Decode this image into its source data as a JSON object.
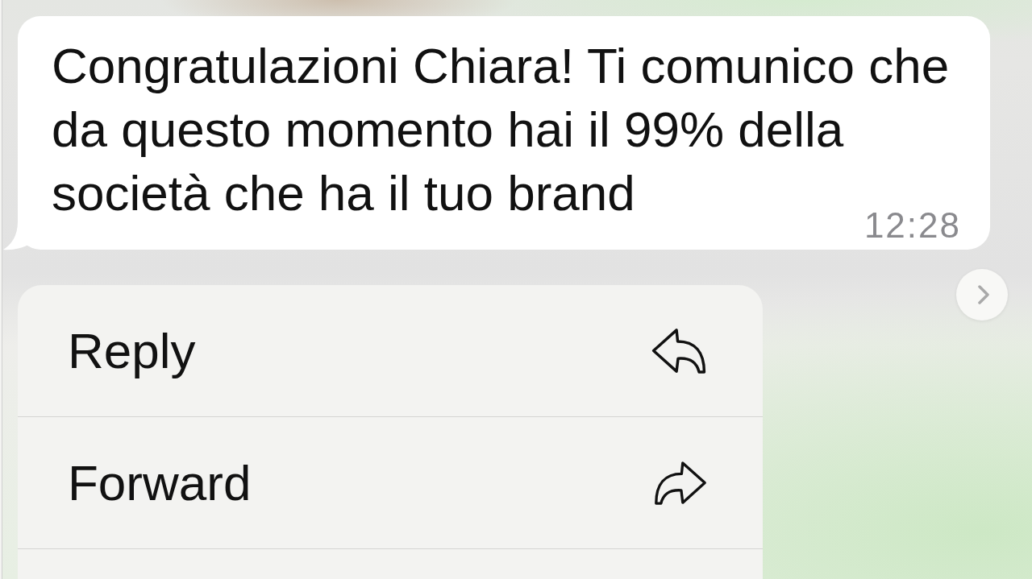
{
  "message": {
    "text": "Congratulazioni Chiara! Ti comunico che da questo momento hai il 99% della società che ha il tuo brand",
    "time": "12:28"
  },
  "context_menu": {
    "items": [
      {
        "label": "Reply",
        "kind": "reply"
      },
      {
        "label": "Forward",
        "kind": "forward"
      }
    ]
  }
}
